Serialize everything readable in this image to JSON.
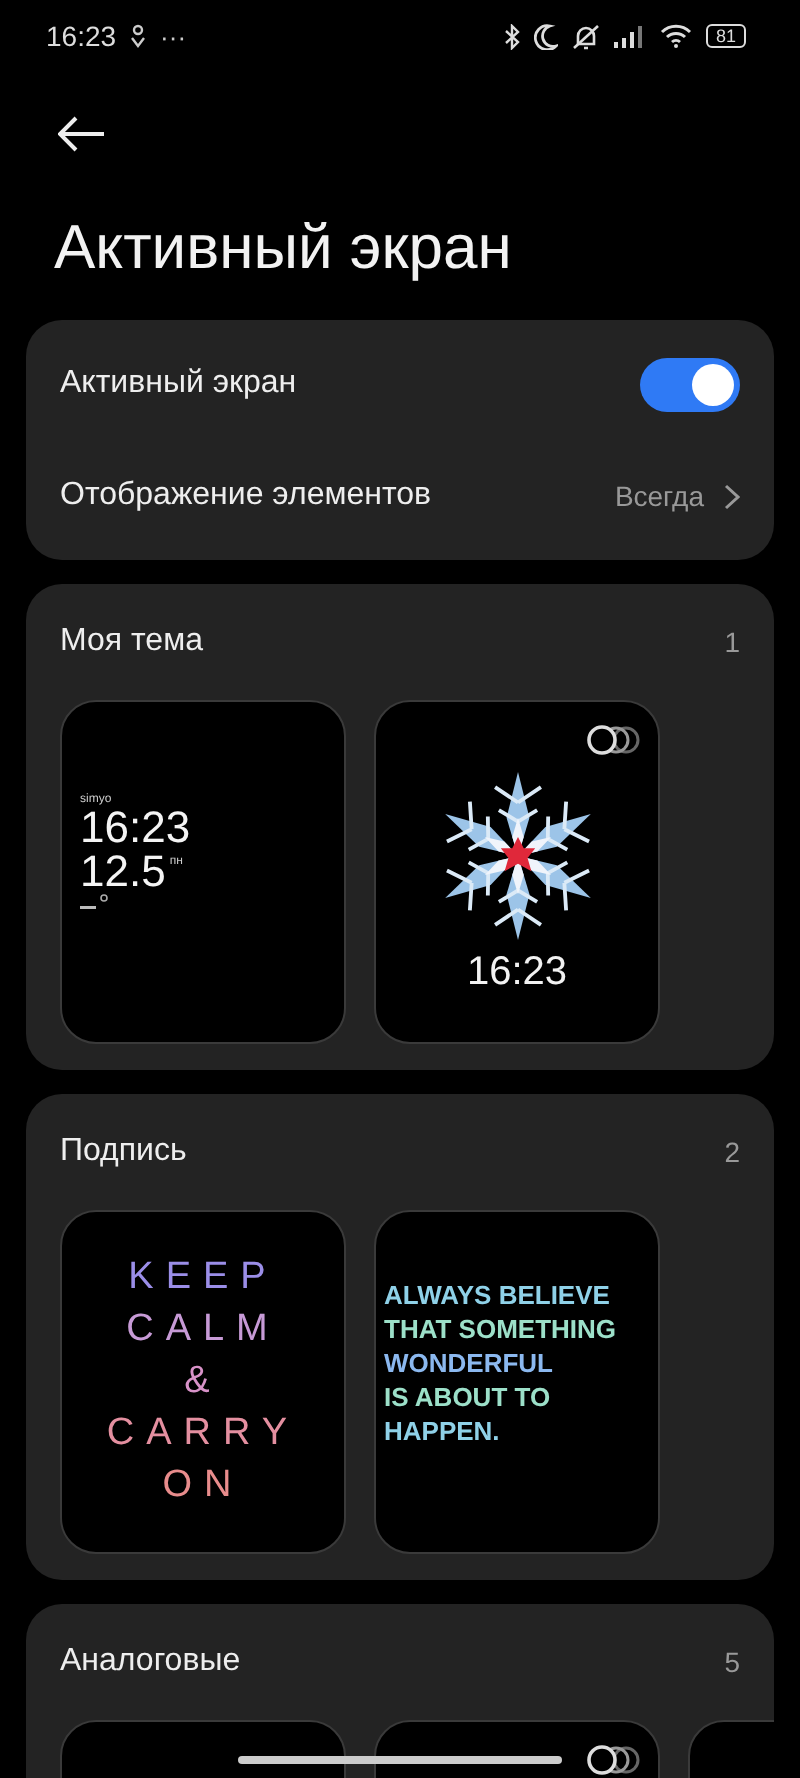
{
  "status_bar": {
    "time": "16:23",
    "dots": "···",
    "battery": "81"
  },
  "title": "Активный экран",
  "settings": [
    {
      "kind": "toggle",
      "label": "Активный экран",
      "on": true
    },
    {
      "kind": "link",
      "label": "Отображение элементов",
      "value": "Всегда"
    }
  ],
  "sections": [
    {
      "title": "Моя тема",
      "count": "1",
      "cards": [
        {
          "kind": "digital",
          "carrier": "simyo",
          "time": "16:23",
          "date": "12.5",
          "weekday": "пн"
        },
        {
          "kind": "snowflake",
          "time": "16:23"
        }
      ]
    },
    {
      "title": "Подпись",
      "count": "2",
      "cards": [
        {
          "kind": "spaced",
          "lines": [
            "KEEP",
            "CALM",
            "&",
            "CARRY",
            "ON"
          ]
        },
        {
          "kind": "quote",
          "lines": [
            "ALWAYS BELIEVE",
            "THAT SOMETHING",
            "WONDERFUL",
            "IS ABOUT TO",
            "HAPPEN."
          ]
        }
      ]
    },
    {
      "title": "Аналоговые",
      "count": "5",
      "cards": [
        {
          "kind": "blank"
        },
        {
          "kind": "styles"
        },
        {
          "kind": "blank"
        }
      ]
    }
  ]
}
